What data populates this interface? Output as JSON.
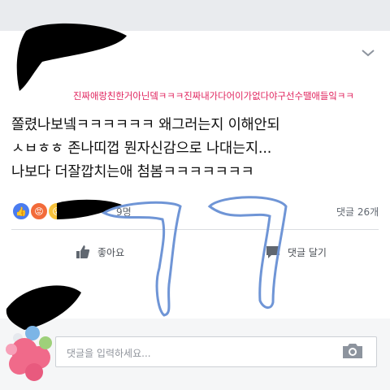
{
  "post": {
    "mention_line": "진짜애랑친한거아닌뎈ㅋㅋㅋ진짜내가다어이가없다야구선수땔애들잌ㅋㅋ",
    "body_lines": [
      "쫄렸나보넼ㅋㅋㅋㅋㅋㅋ 왜그러는지 이해안되",
      "ㅅㅂㅎㅎ 존나띠껍 뭔자신감으로 나대는지...",
      "나보다 더잘깝치는애 첨봄ㅋㅋㅋㅋㅋㅋㅋ"
    ]
  },
  "stats": {
    "reaction_count": "9명",
    "comment_count": "댓글 26개"
  },
  "actions": {
    "like_label": "좋아요",
    "comment_label": "댓글 달기"
  },
  "comment_box": {
    "placeholder": "댓글을 입력하세요..."
  },
  "icons": [
    "chevron-down-icon",
    "like-reaction-icon",
    "angry-reaction-icon",
    "wow-reaction-icon",
    "thumbs-up-icon",
    "comment-bubble-icon",
    "camera-icon"
  ],
  "colors": {
    "mention": "#e0245e",
    "like_blue": "#4a7cf0",
    "scribble": "#6f95d6"
  }
}
